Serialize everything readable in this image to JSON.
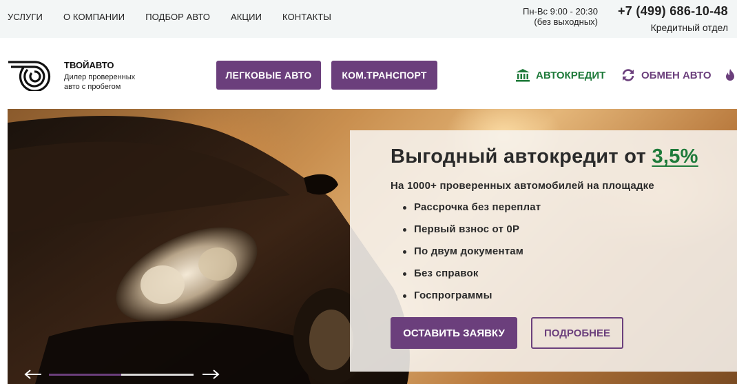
{
  "topnav": {
    "items": [
      {
        "label": "УСЛУГИ"
      },
      {
        "label": "О КОМПАНИИ"
      },
      {
        "label": "ПОДБОР АВТО"
      },
      {
        "label": "АКЦИИ"
      },
      {
        "label": "КОНТАКТЫ"
      }
    ]
  },
  "contacts": {
    "hours": "Пн-Вс 9:00 - 20:30",
    "hours_note": "(без выходных)",
    "phone": "+7 (499) 686-10-48",
    "department": "Кредитный отдел"
  },
  "brand": {
    "name": "ТВОЙАВТО",
    "tagline": "Дилер проверенных авто с пробегом"
  },
  "header": {
    "cars_button": "ЛЕГКОВЫЕ АВТО",
    "trucks_button": "КОМ.ТРАНСПОРТ",
    "credit_link": "АВТОКРЕДИТ",
    "exchange_link": "ОБМЕН АВТО"
  },
  "hero": {
    "title_prefix": "Выгодный автокредит от ",
    "title_rate": "3,5%",
    "subtitle": "На 1000+ проверенных автомобилей на площадке",
    "features": [
      "Рассрочка без переплат",
      "Первый взнос от 0Р",
      "По двум документам",
      "Без справок",
      "Госпрограммы"
    ],
    "apply_button": "ОСТАВИТЬ ЗАЯВКУ",
    "more_button": "ПОДРОБНЕЕ",
    "slider_progress": 0.5
  },
  "colors": {
    "accent_purple": "#6b3f7c",
    "accent_green": "#1e7a3a",
    "topbar_bg": "#f3f6f6"
  },
  "icons": {
    "credit": "bank-icon",
    "exchange": "refresh-icon",
    "hot": "fire-icon",
    "prev": "arrow-left-icon",
    "next": "arrow-right-icon"
  }
}
